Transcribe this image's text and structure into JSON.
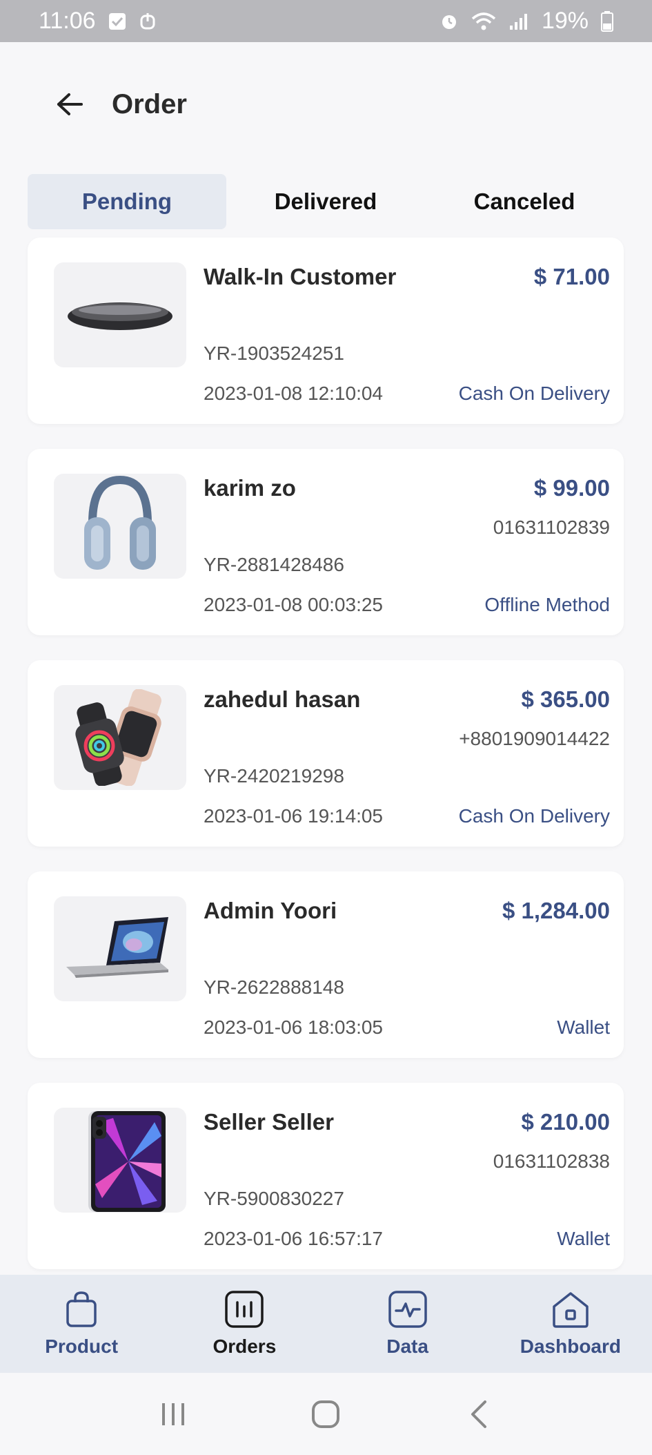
{
  "status_bar": {
    "time": "11:06",
    "battery": "19%"
  },
  "header": {
    "title": "Order"
  },
  "tabs": [
    {
      "label": "Pending",
      "active": true
    },
    {
      "label": "Delivered",
      "active": false
    },
    {
      "label": "Canceled",
      "active": false
    }
  ],
  "orders": [
    {
      "customer": "Walk-In Customer",
      "amount": "$ 71.00",
      "phone": "",
      "order_id": "YR-1903524251",
      "date": "2023-01-08 12:10:04",
      "payment": "Cash On Delivery",
      "product_icon": "mouse-image"
    },
    {
      "customer": "karim zo",
      "amount": "$ 99.00",
      "phone": "01631102839",
      "order_id": "YR-2881428486",
      "date": "2023-01-08 00:03:25",
      "payment": "Offline Method",
      "product_icon": "headphones-image"
    },
    {
      "customer": "zahedul hasan",
      "amount": "$ 365.00",
      "phone": "+8801909014422",
      "order_id": "YR-2420219298",
      "date": "2023-01-06 19:14:05",
      "payment": "Cash On Delivery",
      "product_icon": "smartwatch-image"
    },
    {
      "customer": "Admin Yoori",
      "amount": "$ 1,284.00",
      "phone": "",
      "order_id": "YR-2622888148",
      "date": "2023-01-06 18:03:05",
      "payment": "Wallet",
      "product_icon": "laptop-image"
    },
    {
      "customer": "Seller Seller",
      "amount": "$ 210.00",
      "phone": "01631102838",
      "order_id": "YR-5900830227",
      "date": "2023-01-06 16:57:17",
      "payment": "Wallet",
      "product_icon": "tablet-image"
    }
  ],
  "bottom_nav": [
    {
      "label": "Product",
      "icon": "bag-icon",
      "active": false
    },
    {
      "label": "Orders",
      "icon": "chart-icon",
      "active": true
    },
    {
      "label": "Data",
      "icon": "pulse-icon",
      "active": false
    },
    {
      "label": "Dashboard",
      "icon": "home-icon",
      "active": false
    }
  ],
  "colors": {
    "accent": "#3a4f84",
    "tab_active_bg": "#e6eaf1",
    "status_bar": "#b8b8bc"
  }
}
